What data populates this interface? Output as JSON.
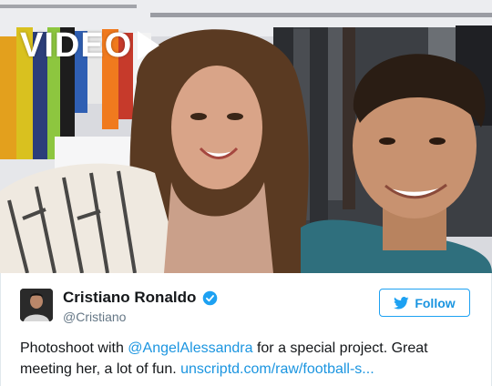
{
  "video": {
    "badge_label": "VIDEO"
  },
  "tweet": {
    "author": {
      "name": "Cristiano Ronaldo",
      "handle": "@Cristiano",
      "verified": true
    },
    "follow_label": "Follow",
    "text": {
      "part1": "Photoshoot with ",
      "mention": "@AngelAlessandra",
      "part2": " for a special project. Great meeting her, a lot of fun. ",
      "link": "unscriptd.com/raw/football-s..."
    }
  },
  "colors": {
    "accent": "#1da1f2",
    "link": "#1b95e0",
    "text": "#14171a",
    "muted": "#657786"
  }
}
